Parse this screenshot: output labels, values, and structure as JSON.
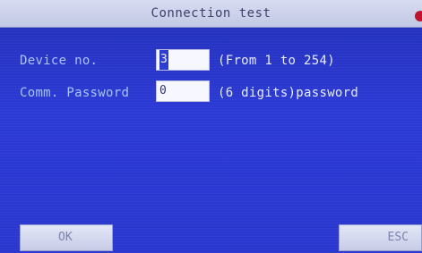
{
  "window": {
    "title": "Connection test"
  },
  "form": {
    "device_no": {
      "label": "Device no.",
      "value": "3",
      "hint": "(From 1 to 254)"
    },
    "comm_password": {
      "label": "Comm. Password",
      "value": "0",
      "hint": "(6 digits)password"
    }
  },
  "buttons": {
    "ok": "OK",
    "esc": "ESC"
  },
  "colors": {
    "background": "#2c3ad6",
    "titlebar": "#d7dbf0",
    "label_text": "#a9c4ff",
    "hint_text": "#e6ecff"
  }
}
